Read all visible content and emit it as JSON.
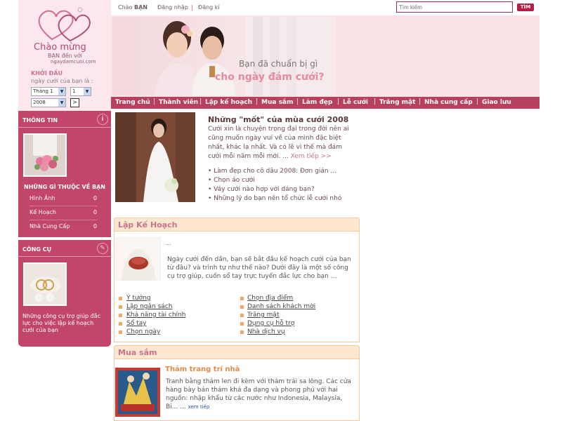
{
  "logo": {
    "line1": "Chào mừng",
    "line2": "BẠN đến với",
    "line3": "ngaydamcuoi.com"
  },
  "start": {
    "heading": "KHỞI ĐẦU",
    "sub": "ngày cưới của bạn là :",
    "month": "Tháng 1",
    "day": "1",
    "year": "2008",
    "go": ">"
  },
  "topbar": {
    "greeting": "Chào",
    "greeting_name": "BẠN",
    "login": "Đăng nhập",
    "sep": "|",
    "register": "Đăng kí",
    "search_placeholder": "Tìm kiếm",
    "search_button": "TÌM"
  },
  "banner": {
    "line1": "Bạn đã chuẩn bị gì",
    "line2": "cho ngày đám cưới?"
  },
  "nav": [
    "Trang chủ",
    "Thành viên",
    "Lập kế hoạch",
    "Mua sắm",
    "Làm đẹp",
    "Lễ cưới",
    "Trăng mật",
    "Nhà cung cấp",
    "Giao lưu"
  ],
  "info_panel": {
    "title": "THÔNG TIN",
    "belong_title": "NHỮNG GÌ THUỘC VỀ BẠN",
    "rows": [
      {
        "label": "Hình Ảnh",
        "value": "0"
      },
      {
        "label": "Kế Hoạch",
        "value": "0"
      },
      {
        "label": "Nhà Cung Cấp",
        "value": "0"
      }
    ]
  },
  "tool_panel": {
    "title": "CÔNG CỤ",
    "desc": "Những công cụ trợ giúp đắc lực cho việc lập kế hoạch cưới của bạn"
  },
  "feature": {
    "title": "Những \"mốt\" của mùa cưới 2008",
    "body": "Cưới xin là chuyện trọng đại trong đời nên ai cũng muốn ngày vui về của mình đặc biệt nhất, khác lạ nhất. Và có lẽ vì thế mà đám cưới mỗi năm mỗi mới. ...",
    "more": "Xem tiếp >>",
    "list": [
      "• Làm đẹp cho cô dâu 2008: Đơn giản ...",
      "• Chọn áo cưới",
      "• Váy cưới nào hợp với dáng bạn?",
      "• Những lý do bạn nên tổ chức lễ cưới nhỏ"
    ]
  },
  "plan": {
    "title": "Lập Kế Hoạch",
    "dots": "...",
    "text": "Ngày cưới đến dần, bạn sẽ bắt đầu kế hoạch cưới của bạn từ đâu? và trình tự như thế nào? Dưới đây là một số công cụ trợ giúp, cuốn sổ tay trực tuyến đắc lực cho bạn ...",
    "links_left": [
      "Ý tưởng",
      "Lập ngân sách",
      "Khả năng tài chính",
      "Sổ tay",
      "Chọn ngày"
    ],
    "links_right": [
      "Chọn địa điểm",
      "Danh sách khách mời",
      "Trăng mật",
      "Dụng cụ hỗ trợ",
      "Nhà dịch vụ"
    ]
  },
  "shop": {
    "title": "Mua sắm",
    "item_title": "Thảm trang trí nhà",
    "text": "Tranh bằng thảm len đi kèm với thảm trải sa lông. Các cửa hàng bày bán thảm khá đa dạng và phong phú với hai nguồn: nhập khẩu từ các nước như Indonesia, Malaysia, Bỉ... ...",
    "more": "xem tiếp"
  },
  "colors": {
    "accent": "#b7405f",
    "panel": "#c2466a",
    "section_head": "#fde7d0"
  }
}
